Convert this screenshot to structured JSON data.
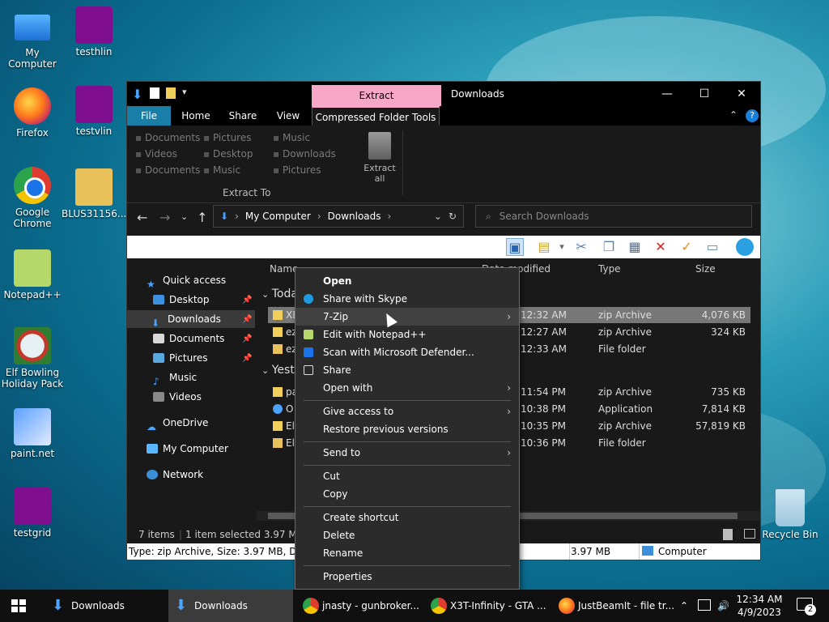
{
  "desktop": {
    "icons": [
      {
        "label": "My Computer"
      },
      {
        "label": "testhlin"
      },
      {
        "label": "Firefox"
      },
      {
        "label": "testvlin"
      },
      {
        "label": "Google Chrome"
      },
      {
        "label": "BLUS31156..."
      },
      {
        "label": "Notepad++"
      },
      {
        "label": "Elf Bowling Holiday Pack"
      },
      {
        "label": "paint.net"
      },
      {
        "label": "testgrid"
      },
      {
        "label": "Recycle Bin"
      }
    ]
  },
  "window": {
    "title": "Downloads",
    "context_tab": "Extract",
    "tabs": [
      "File",
      "Home",
      "Share",
      "View",
      "Compressed Folder Tools"
    ],
    "ribbon": {
      "destinations": [
        "Documents",
        "Pictures",
        "Music",
        "Videos",
        "Desktop",
        "Downloads",
        "Documents",
        "Music",
        "Pictures"
      ],
      "group_label": "Extract To",
      "extract_all": "Extract all"
    },
    "address": {
      "parts": [
        "My Computer",
        "Downloads"
      ]
    },
    "search_placeholder": "Search Downloads",
    "nav": {
      "items": [
        "Quick access",
        "Desktop",
        "Downloads",
        "Documents",
        "Pictures",
        "Music",
        "Videos",
        "OneDrive",
        "My Computer",
        "Network"
      ]
    },
    "columns": [
      "Name",
      "Date modified",
      "Type",
      "Size"
    ],
    "groups": [
      "Toda",
      "Yest"
    ],
    "rows": [
      {
        "name": "XE",
        "date": "12:32 AM",
        "type": "zip Archive",
        "size": "4,076 KB"
      },
      {
        "name": "ez",
        "date": "12:27 AM",
        "type": "zip Archive",
        "size": "324 KB"
      },
      {
        "name": "ez",
        "date": "12:33 AM",
        "type": "File folder",
        "size": ""
      },
      {
        "name": "pa",
        "date": "11:54 PM",
        "type": "zip Archive",
        "size": "735 KB"
      },
      {
        "name": "O",
        "date": "10:38 PM",
        "type": "Application",
        "size": "7,814 KB"
      },
      {
        "name": "El",
        "date": "10:35 PM",
        "type": "zip Archive",
        "size": "57,819 KB"
      },
      {
        "name": "El",
        "date": "10:36 PM",
        "type": "File folder",
        "size": ""
      }
    ],
    "status": {
      "count": "7 items",
      "selected": "1 item selected  3.97 MB"
    },
    "info": {
      "desc": "Type: zip Archive, Size: 3.97 MB, Date m",
      "size": "3.97 MB",
      "location": "Computer"
    }
  },
  "context_menu": {
    "items": [
      "Open",
      "Share with Skype",
      "7-Zip",
      "Edit with Notepad++",
      "Scan with Microsoft Defender...",
      "Share",
      "Open with",
      "Give access to",
      "Restore previous versions",
      "Send to",
      "Cut",
      "Copy",
      "Create shortcut",
      "Delete",
      "Rename",
      "Properties"
    ]
  },
  "taskbar": {
    "buttons": [
      "Downloads",
      "Downloads",
      "jnasty - gunbroker...",
      "X3T-Infinity - GTA ...",
      "JustBeamIt - file tr..."
    ],
    "time": "12:34 AM",
    "date": "4/9/2023",
    "notifications": "2"
  },
  "colors": {
    "accent": "#1a7fa8",
    "extract_tab": "#f7a8c6",
    "selection": "#777777"
  }
}
